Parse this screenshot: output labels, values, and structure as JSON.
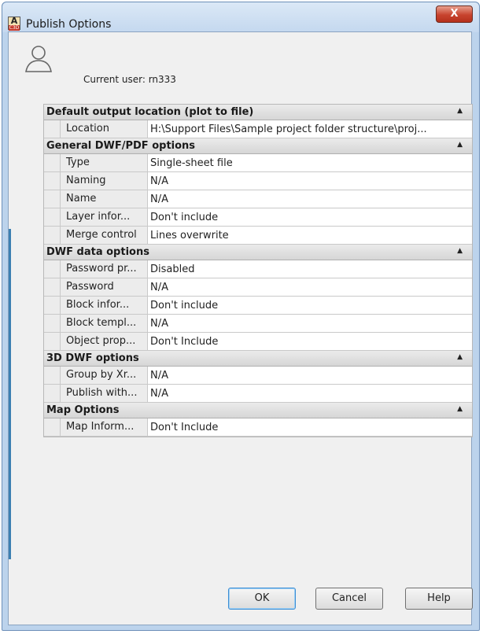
{
  "window": {
    "title": "Publish Options",
    "app_icon_letter": "A",
    "app_icon_badge": "C3D",
    "close_label": "X"
  },
  "user": {
    "label": "Current user: rn333"
  },
  "sections": [
    {
      "title": "Default output location (plot to file)",
      "rows": [
        {
          "name": "Location",
          "value": "H:\\Support Files\\Sample project folder structure\\proj..."
        }
      ]
    },
    {
      "title": "General DWF/PDF options",
      "rows": [
        {
          "name": "Type",
          "value": "Single-sheet file"
        },
        {
          "name": "Naming",
          "value": "N/A"
        },
        {
          "name": "Name",
          "value": "N/A"
        },
        {
          "name": "Layer infor...",
          "value": "Don't include"
        },
        {
          "name": "Merge control",
          "value": "Lines overwrite"
        }
      ]
    },
    {
      "title": "DWF data options",
      "rows": [
        {
          "name": "Password pr...",
          "value": "Disabled"
        },
        {
          "name": "Password",
          "value": "N/A"
        },
        {
          "name": "Block infor...",
          "value": "Don't include"
        },
        {
          "name": "Block templ...",
          "value": "N/A"
        },
        {
          "name": "Object prop...",
          "value": "Don't Include"
        }
      ]
    },
    {
      "title": "3D DWF options",
      "rows": [
        {
          "name": "Group by Xr...",
          "value": "N/A"
        },
        {
          "name": "Publish with...",
          "value": "N/A"
        }
      ]
    },
    {
      "title": "Map Options",
      "rows": [
        {
          "name": "Map Inform...",
          "value": "Don't Include"
        }
      ]
    }
  ],
  "buttons": {
    "ok": "OK",
    "cancel": "Cancel",
    "help": "Help"
  },
  "icons": {
    "collapse": "collapse-arrow-up-icon",
    "user": "user-silhouette-icon",
    "app": "civil3d-app-icon"
  }
}
